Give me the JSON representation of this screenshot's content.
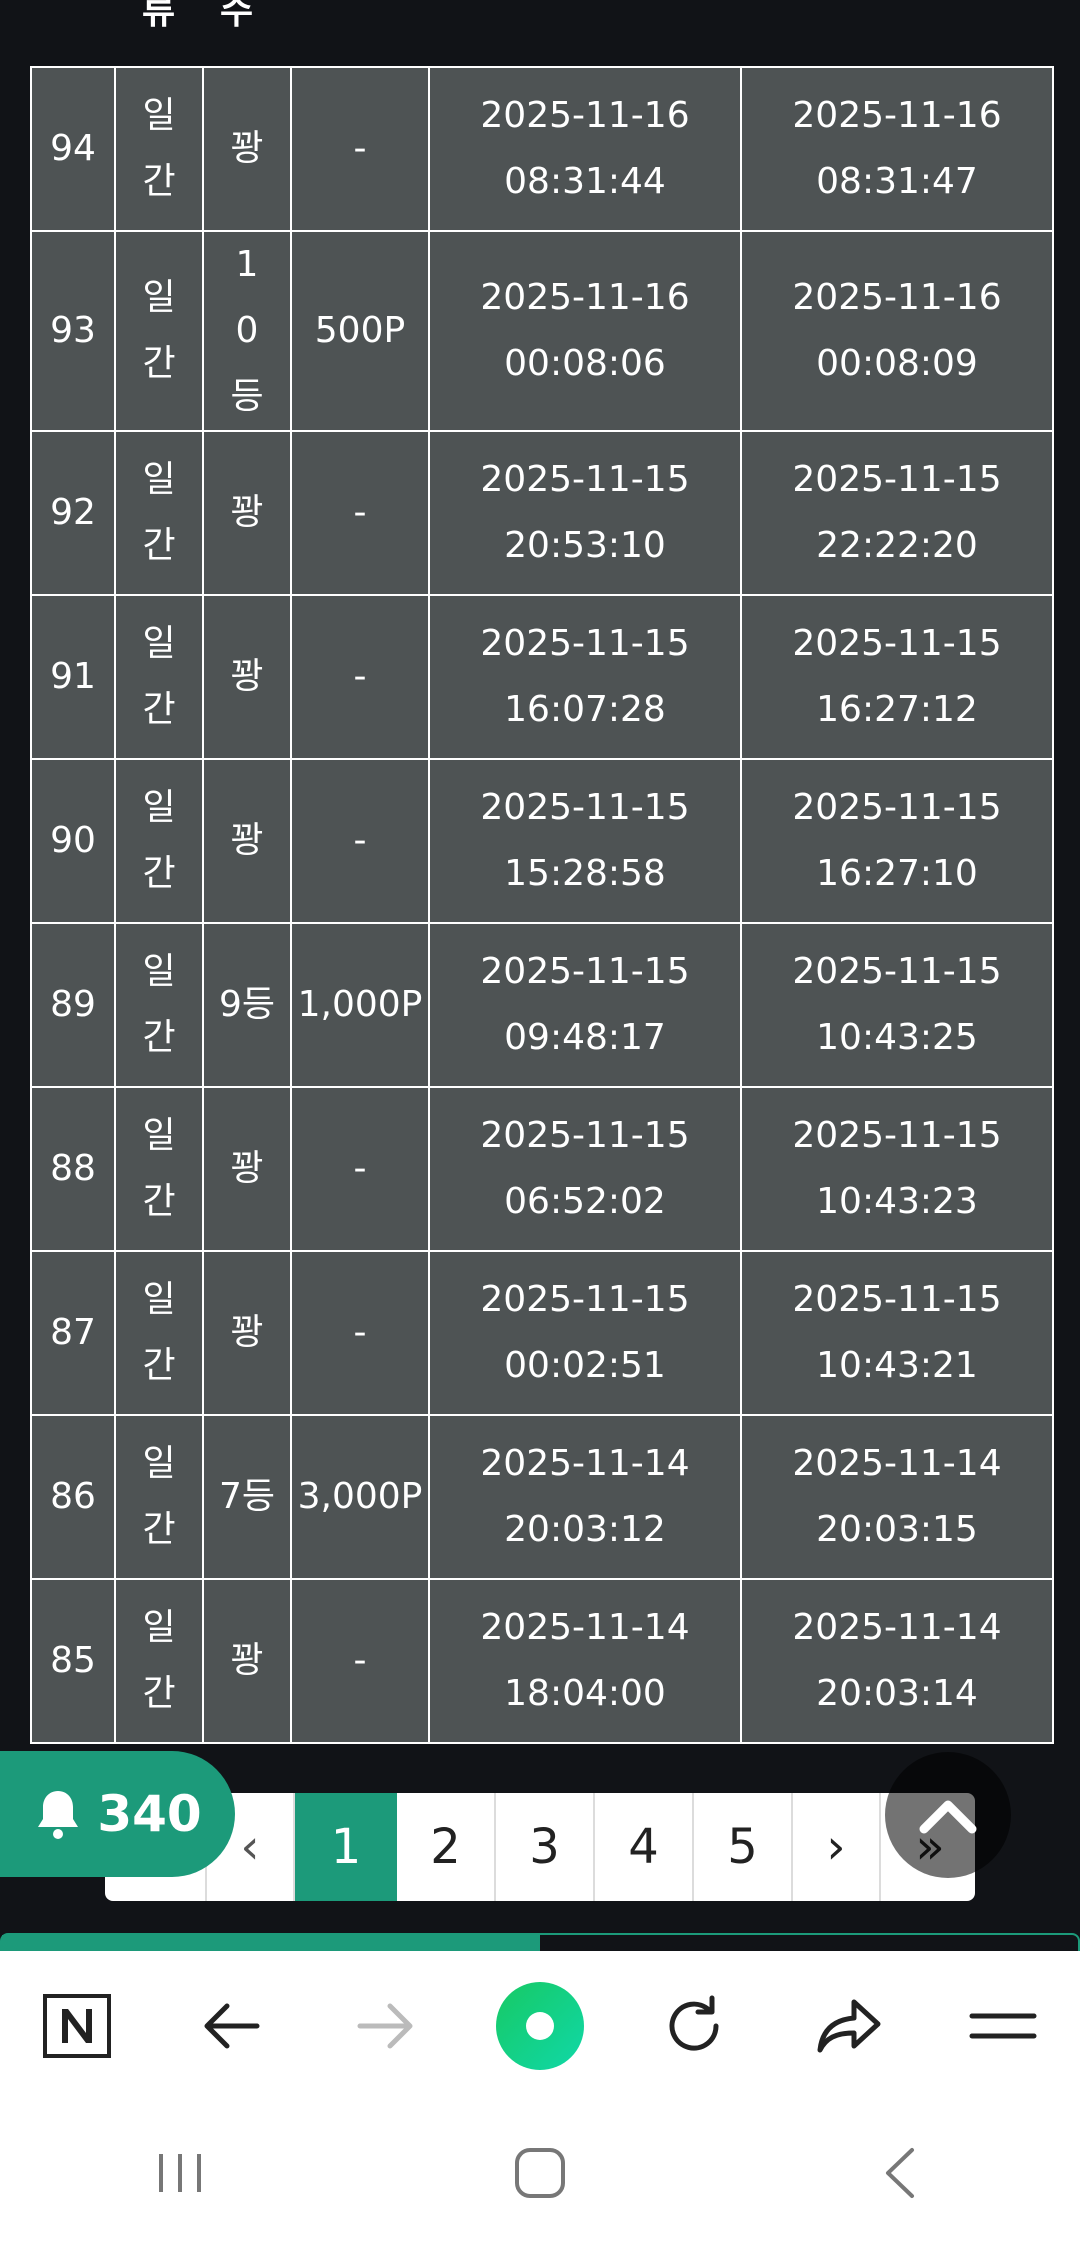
{
  "table": {
    "header_partial": [
      "류",
      "수"
    ],
    "rows": [
      {
        "no": "94",
        "type": "일간",
        "rank": "꽝",
        "prize": "-",
        "start_date": "2025-11-16",
        "start_time": "08:31:44",
        "end_date": "2025-11-16",
        "end_time": "08:31:47"
      },
      {
        "no": "93",
        "type": "일간",
        "rank": "10등",
        "prize": "500P",
        "start_date": "2025-11-16",
        "start_time": "00:08:06",
        "end_date": "2025-11-16",
        "end_time": "00:08:09"
      },
      {
        "no": "92",
        "type": "일간",
        "rank": "꽝",
        "prize": "-",
        "start_date": "2025-11-15",
        "start_time": "20:53:10",
        "end_date": "2025-11-15",
        "end_time": "22:22:20"
      },
      {
        "no": "91",
        "type": "일간",
        "rank": "꽝",
        "prize": "-",
        "start_date": "2025-11-15",
        "start_time": "16:07:28",
        "end_date": "2025-11-15",
        "end_time": "16:27:12"
      },
      {
        "no": "90",
        "type": "일간",
        "rank": "꽝",
        "prize": "-",
        "start_date": "2025-11-15",
        "start_time": "15:28:58",
        "end_date": "2025-11-15",
        "end_time": "16:27:10"
      },
      {
        "no": "89",
        "type": "일간",
        "rank": "9등",
        "prize": "1,000P",
        "start_date": "2025-11-15",
        "start_time": "09:48:17",
        "end_date": "2025-11-15",
        "end_time": "10:43:25"
      },
      {
        "no": "88",
        "type": "일간",
        "rank": "꽝",
        "prize": "-",
        "start_date": "2025-11-15",
        "start_time": "06:52:02",
        "end_date": "2025-11-15",
        "end_time": "10:43:23"
      },
      {
        "no": "87",
        "type": "일간",
        "rank": "꽝",
        "prize": "-",
        "start_date": "2025-11-15",
        "start_time": "00:02:51",
        "end_date": "2025-11-15",
        "end_time": "10:43:21"
      },
      {
        "no": "86",
        "type": "일간",
        "rank": "7등",
        "prize": "3,000P",
        "start_date": "2025-11-14",
        "start_time": "20:03:12",
        "end_date": "2025-11-14",
        "end_time": "20:03:15"
      },
      {
        "no": "85",
        "type": "일간",
        "rank": "꽝",
        "prize": "-",
        "start_date": "2025-11-14",
        "start_time": "18:04:00",
        "end_date": "2025-11-14",
        "end_time": "20:03:14"
      }
    ]
  },
  "notification": {
    "count": "340",
    "icon": "bell-icon"
  },
  "pagination": {
    "prev_label": "‹",
    "pages": [
      "1",
      "2",
      "3",
      "4",
      "5"
    ],
    "active_page": "1",
    "next_label": "›",
    "last_label": "»"
  },
  "scroll_top": {
    "icon": "chevron-up-icon"
  },
  "progress": {
    "fraction": 0.5
  },
  "browser_bar": {
    "icons": [
      "naver-n-icon",
      "back-arrow-icon",
      "forward-arrow-icon",
      "home-green-circle-icon",
      "refresh-icon",
      "share-icon",
      "menu-icon"
    ]
  },
  "system_nav": {
    "icons": [
      "recent-apps-icon",
      "home-icon",
      "back-icon"
    ]
  },
  "colors": {
    "accent": "#1c9a7a",
    "table_cell": "#4e5354",
    "background": "#111317"
  }
}
